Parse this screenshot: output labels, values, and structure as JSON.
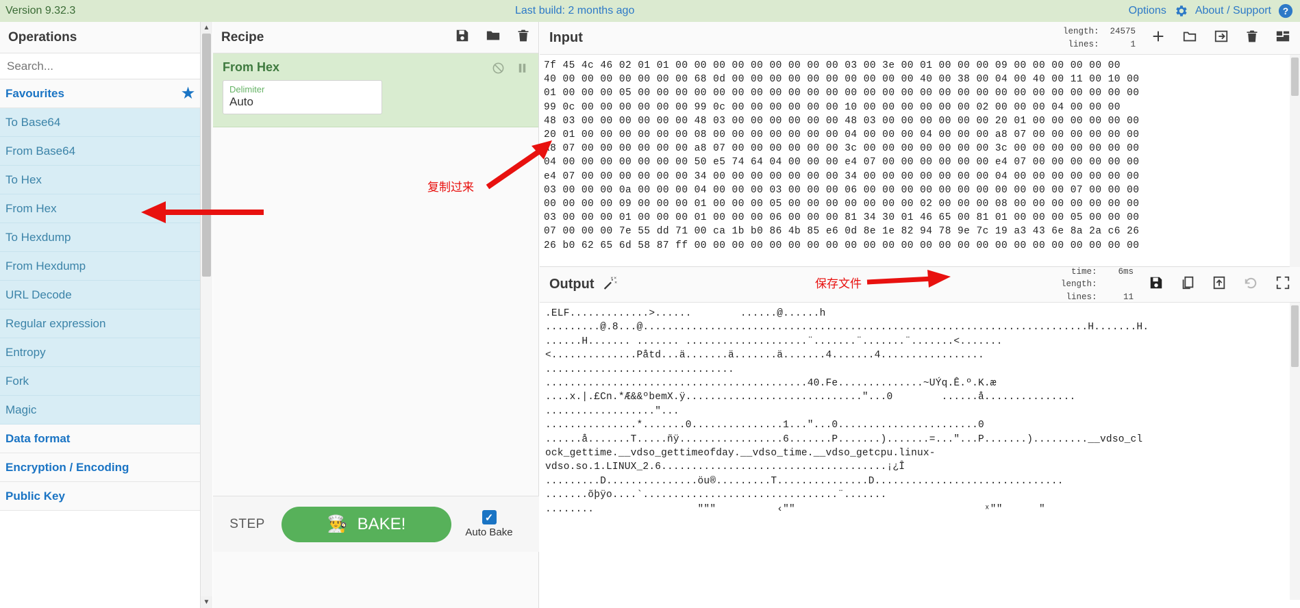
{
  "banner": {
    "version": "Version 9.32.3",
    "build": "Last build: 2 months ago",
    "options": "Options",
    "about": "About / Support",
    "bg_color": "#dbead0",
    "link_color": "#2d79c7"
  },
  "operations": {
    "title": "Operations",
    "search_placeholder": "Search...",
    "search_value": "",
    "favourites_label": "Favourites",
    "favourite_ops": [
      "To Base64",
      "From Base64",
      "To Hex",
      "From Hex",
      "To Hexdump",
      "From Hexdump",
      "URL Decode",
      "Regular expression",
      "Entropy",
      "Fork",
      "Magic"
    ],
    "categories": [
      "Data format",
      "Encryption / Encoding",
      "Public Key"
    ]
  },
  "recipe": {
    "title": "Recipe",
    "icons": [
      "save-icon",
      "folder-icon",
      "trash-icon"
    ],
    "operation": {
      "name": "From Hex",
      "disable_icon": "disable-icon",
      "pause_icon": "pause-icon",
      "arg_label": "Delimiter",
      "arg_value": "Auto"
    },
    "controls": {
      "step_label": "STEP",
      "bake_label": "BAKE!",
      "bake_icon": "chef-icon",
      "auto_bake_label": "Auto Bake",
      "auto_bake_checked": true,
      "bake_color": "#57b15a"
    }
  },
  "input": {
    "title": "Input",
    "length_label": "length:",
    "length_value": "24575",
    "lines_label": "lines:",
    "lines_value": "1",
    "icons": [
      "plus-icon",
      "folder-open-icon",
      "open-in-icon",
      "trash-icon",
      "layout-icon"
    ],
    "hex_lines": [
      "7f 45 4c 46 02 01 01 00 00 00 00 00 00 00 00 00 03 00 3e 00 01 00 00 00 09 00 00 00 00 00 00",
      "40 00 00 00 00 00 00 00 68 0d 00 00 00 00 00 00 00 00 00 00 40 00 38 00 04 00 40 00 11 00 10 00",
      "01 00 00 00 05 00 00 00 00 00 00 00 00 00 00 00 00 00 00 00 00 00 00 00 00 00 00 00 00 00 00 00",
      "99 0c 00 00 00 00 00 00 99 0c 00 00 00 00 00 00 10 00 00 00 00 00 00 02 00 00 00 04 00 00 00",
      "48 03 00 00 00 00 00 00 48 03 00 00 00 00 00 00 48 03 00 00 00 00 00 00 20 01 00 00 00 00 00 00",
      "20 01 00 00 00 00 00 00 08 00 00 00 00 00 00 00 04 00 00 00 04 00 00 00 a8 07 00 00 00 00 00 00",
      "a8 07 00 00 00 00 00 00 a8 07 00 00 00 00 00 00 3c 00 00 00 00 00 00 00 3c 00 00 00 00 00 00 00",
      "04 00 00 00 00 00 00 00 50 e5 74 64 04 00 00 00 e4 07 00 00 00 00 00 00 e4 07 00 00 00 00 00 00",
      "e4 07 00 00 00 00 00 00 34 00 00 00 00 00 00 00 34 00 00 00 00 00 00 00 04 00 00 00 00 00 00 00",
      "03 00 00 00 0a 00 00 00 04 00 00 00 03 00 00 00 06 00 00 00 00 00 00 00 00 00 00 00 07 00 00 00",
      "00 00 00 00 09 00 00 00 01 00 00 00 05 00 00 00 00 00 00 00 02 00 00 00 08 00 00 00 00 00 00 00",
      "03 00 00 00 01 00 00 00 01 00 00 00 06 00 00 00 81 34 30 01 46 65 00 81 01 00 00 00 05 00 00 00",
      "07 00 00 00 7e 55 dd 71 00 ca 1b b0 86 4b 85 e6 0d 8e 1e 82 94 78 9e 7c 19 a3 43 6e 8a 2a c6 26",
      "26 b0 62 65 6d 58 87 ff 00 00 00 00 00 00 00 00 00 00 00 00 00 00 00 00 00 00 00 00 00 00 00 00"
    ]
  },
  "output": {
    "title": "Output",
    "magic_icon": "magic-wand-icon",
    "time_label": "time:",
    "time_value": "6ms",
    "length_label": "length:",
    "length_value": "",
    "lines_label": "lines:",
    "lines_value": "11",
    "icons": [
      "save-icon",
      "copy-icon",
      "open-in-tab-icon",
      "undo-icon",
      "fullscreen-icon"
    ],
    "text_lines": [
      ".ELF.............>......        ......@......h",
      ".........@.8...@.........................................................................H.......H.",
      "......H....... ....... ....................¨.......¨.......¨.......<.......",
      "<..............Påtd...ä.......ä.......ä.......4.......4.................",
      "...............................",
      "...........................................40.Fe..............~UÝq.Ê.º.K.æ",
      "....x.|.£Cn.*Æ&&ºbemX.ÿ.............................\"...0        ......å...............",
      "..................\"...",
      "...............*.......0...............1...\"...0.......................0",
      "......å.......T.....ñÿ.................6.......P.......).......=...\"...P.......).........__vdso_cl",
      "ock_gettime.__vdso_gettimeofday.__vdso_time.__vdso_getcpu.linux-",
      "vdso.so.1.LINUX_2.6.....................................¡¿Î",
      ".........D...............öu®.........T...............D...............................",
      ".......õþÿo....`................................¨.......",
      "........                 \"\"\"          ‹\"\"                               ˣ\"\"      \""
    ]
  },
  "annotations": [
    {
      "id": "from-hex-arrow",
      "text": ""
    },
    {
      "id": "copy-over",
      "text": "复制过来"
    },
    {
      "id": "save-file",
      "text": "保存文件"
    }
  ],
  "colors": {
    "red_annotation": "#e8110f",
    "banner_green": "#dbead0",
    "op_blue": "#3b83a8",
    "fav_bg": "#d8edf5"
  }
}
